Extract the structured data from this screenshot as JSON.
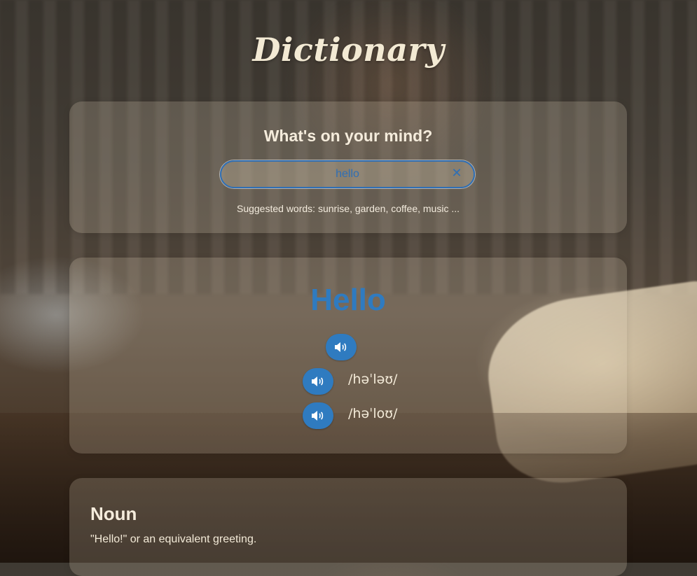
{
  "app": {
    "title": "Dictionary"
  },
  "search": {
    "prompt": "What's on your mind?",
    "value": "hello",
    "clear_icon": "✕",
    "suggestions": "Suggested words: sunrise, garden, coffee, music ..."
  },
  "result": {
    "word": "Hello",
    "pronunciations": [
      {
        "phonetic": ""
      },
      {
        "phonetic": "/həˈləʊ/"
      },
      {
        "phonetic": "/həˈloʊ/"
      }
    ],
    "meanings": [
      {
        "part_of_speech": "Noun",
        "definition": "\"Hello!\" or an equivalent greeting."
      }
    ]
  },
  "icons": {
    "audio": "speaker-icon",
    "clear": "close-icon"
  },
  "colors": {
    "accent": "#2f7bc0",
    "title": "#f3ead4",
    "text": "#f3ead8"
  }
}
